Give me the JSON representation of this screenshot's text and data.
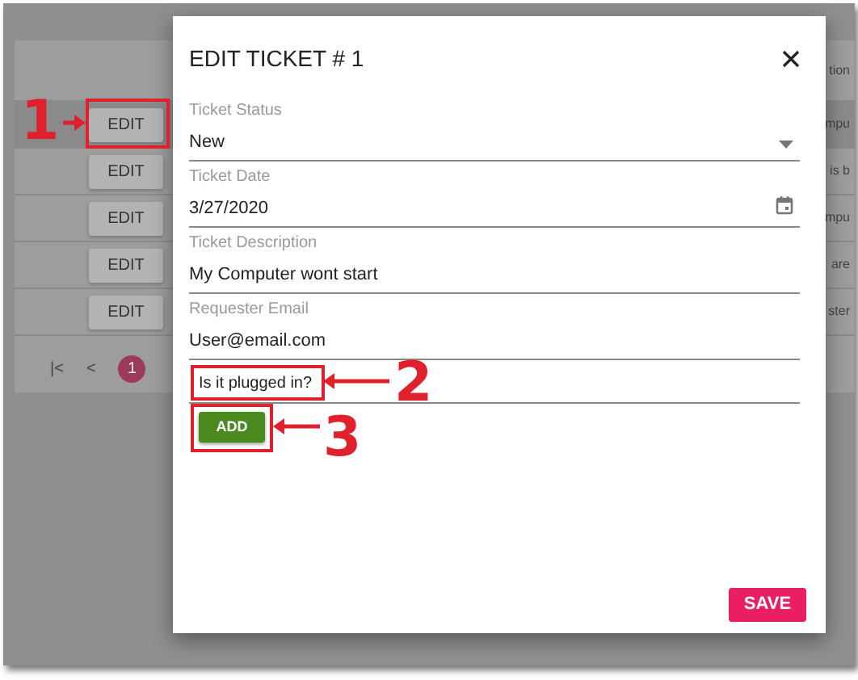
{
  "background_table": {
    "header_fragment": "tion",
    "rows": [
      {
        "button": "EDIT",
        "fragment": "mpu",
        "selected": true
      },
      {
        "button": "EDIT",
        "fragment": "is b",
        "selected": false
      },
      {
        "button": "EDIT",
        "fragment": "mpu",
        "selected": false
      },
      {
        "button": "EDIT",
        "fragment": "are",
        "selected": false
      },
      {
        "button": "EDIT",
        "fragment": "ster",
        "selected": false
      }
    ],
    "pagination": {
      "first": "|<",
      "prev": "<",
      "pages": [
        {
          "label": "1",
          "selected": true
        }
      ]
    }
  },
  "modal": {
    "title": "EDIT TICKET # 1",
    "fields": [
      {
        "kind": "select",
        "label": "Ticket Status",
        "value": "New"
      },
      {
        "kind": "date",
        "label": "Ticket Date",
        "value": "3/27/2020"
      },
      {
        "kind": "text",
        "label": "Ticket Description",
        "value": "My Computer wont start"
      },
      {
        "kind": "text",
        "label": "Requester Email",
        "value": "User@email.com"
      }
    ],
    "note": {
      "value": "Is it plugged in?"
    },
    "add_button": "ADD",
    "save_button": "SAVE"
  },
  "annotations": [
    {
      "number": "1"
    },
    {
      "number": "2"
    },
    {
      "number": "3"
    }
  ]
}
